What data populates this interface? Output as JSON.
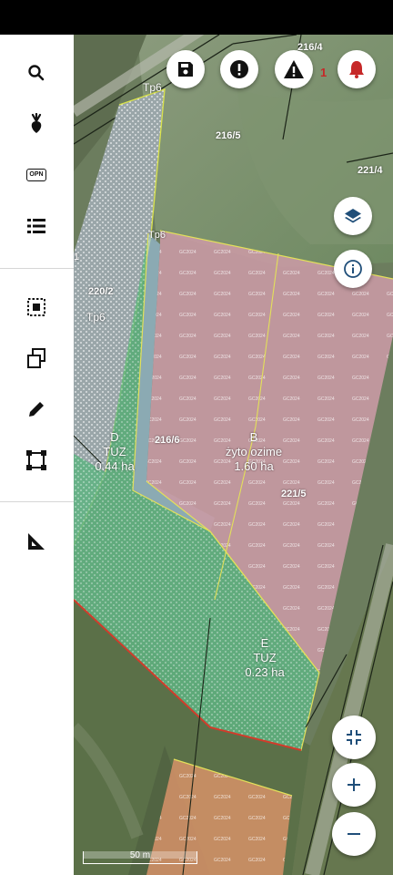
{
  "map": {
    "parcel_numbers": [
      "216/4",
      "216/5",
      "221/4",
      "220/2",
      "216/6",
      "221/5"
    ],
    "zone_labels": [
      "Tp6",
      "Tp6",
      "Tp6"
    ],
    "fields": [
      {
        "letter": "D",
        "crop": "TUZ",
        "area": "0.44 ha"
      },
      {
        "letter": "B",
        "crop": "żyto ozime",
        "area": "1.60 ha"
      },
      {
        "letter": "E",
        "crop": "TUZ",
        "area": "0.23 ha"
      }
    ],
    "edge_fragment": "1",
    "alert_count": "1",
    "scale_label": "50 m",
    "pattern_text": "GC2024"
  },
  "sidebar": {
    "opn_label": "OPN"
  },
  "colors": {
    "crop_fill": "#c99aa4",
    "grass_fill": "#5fb383",
    "hatched_fill": "#9aa6a9",
    "buffer_fill": "#a0c8ec",
    "alert_red": "#c62828",
    "icon_blue": "#1f4e79"
  }
}
